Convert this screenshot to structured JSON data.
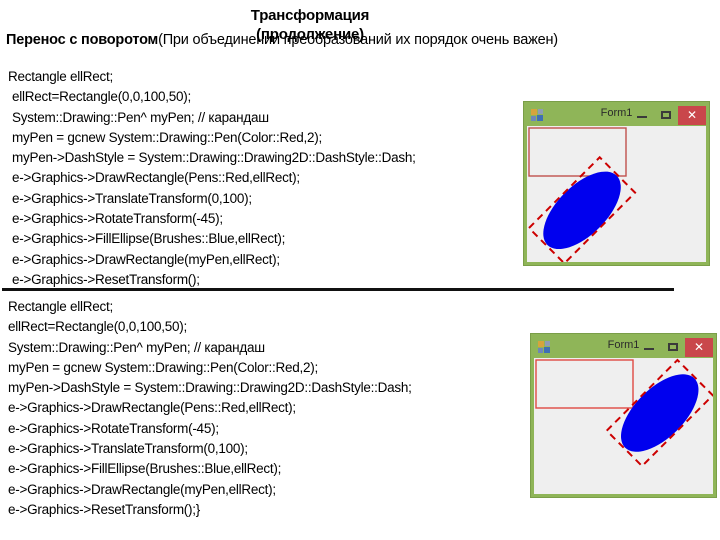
{
  "slide": {
    "title_line1": "Трансформация",
    "title_line2": "(продолжение)",
    "lead_strong": "Перенос с поворотом",
    "lead_rest": "(При объединении преобразований их порядок очень важен)"
  },
  "divider": {
    "color": "#111111"
  },
  "code_block_1": {
    "lines": [
      "Rectangle ellRect;",
      "ellRect=Rectangle(0,0,100,50);",
      "System::Drawing::Pen^  myPen; // карандаш",
      "myPen = gcnew System::Drawing::Pen(Color::Red,2);",
      "myPen->DashStyle = System::Drawing::Drawing2D::DashStyle::Dash;",
      "e->Graphics->DrawRectangle(Pens::Red,ellRect);",
      "e->Graphics->TranslateTransform(0,100);",
      "e->Graphics->RotateTransform(-45);",
      "e->Graphics->FillEllipse(Brushes::Blue,ellRect);",
      "e->Graphics->DrawRectangle(myPen,ellRect);",
      "e->Graphics->ResetTransform();"
    ]
  },
  "code_block_2": {
    "lines": [
      "Rectangle ellRect;",
      "ellRect=Rectangle(0,0,100,50);",
      "System::Drawing::Pen^  myPen; // карандаш",
      "myPen = gcnew System::Drawing::Pen(Color::Red,2);",
      "myPen->DashStyle = System::Drawing::Drawing2D::DashStyle::Dash;",
      "e->Graphics->DrawRectangle(Pens::Red,ellRect);",
      "e->Graphics->RotateTransform(-45);",
      "e->Graphics->TranslateTransform(0,100);",
      "e->Graphics->FillEllipse(Brushes::Blue,ellRect);",
      "e->Graphics->DrawRectangle(myPen,ellRect);",
      "e->Graphics->ResetTransform();}"
    ]
  },
  "form_window_1": {
    "title": "Form1",
    "minimize_label": "",
    "maximize_label": "",
    "close_label": "✕",
    "colors": {
      "chrome": "#8FB558",
      "client": "#EFEFEF",
      "close_button": "#C9474B",
      "solid_rect": "#C0504D",
      "dashed_rect": "#CC0000",
      "ellipse_fill": "#0000EE"
    }
  },
  "form_window_2": {
    "title": "Form1",
    "minimize_label": "",
    "maximize_label": "",
    "close_label": "✕",
    "colors": {
      "chrome": "#8FB558",
      "client": "#EFEFEF",
      "close_button": "#C9474B",
      "solid_rect": "#E04A43",
      "dashed_rect": "#CC0000",
      "ellipse_fill": "#0000EE"
    }
  }
}
